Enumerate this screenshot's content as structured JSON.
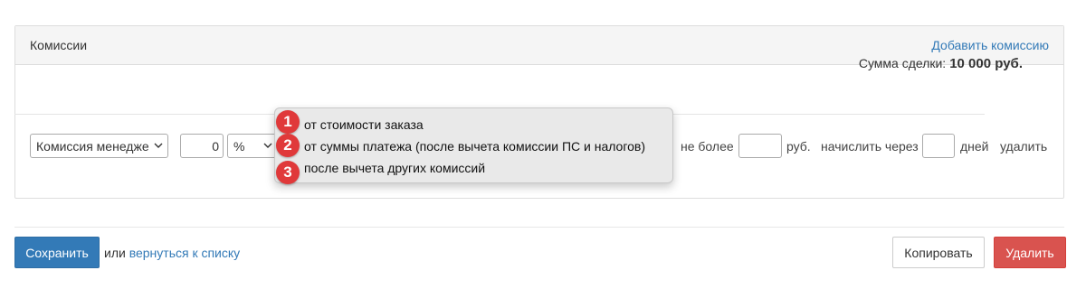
{
  "panel": {
    "title": "Комиссии",
    "add_link": "Добавить комиссию"
  },
  "deal_sum": {
    "label": "Сумма сделки:",
    "value": "10 000 руб."
  },
  "commission_row": {
    "type_select": "Комиссия менедже",
    "amount": "0",
    "unit_select": "%",
    "max_label": "не более",
    "max_value": "",
    "currency": "руб.",
    "accrue_label": "начислить через",
    "days_value": "",
    "days_label": "дней",
    "delete_link": "удалить"
  },
  "dropdown": {
    "options": [
      {
        "badge": "1",
        "label": "от стоимости заказа"
      },
      {
        "badge": "2",
        "label": "от суммы платежа (после вычета комиссии ПС и налогов)"
      },
      {
        "badge": "3",
        "label": "после вычета других комиссий"
      }
    ]
  },
  "footer": {
    "save_label": "Сохранить",
    "or_text": "или",
    "back_link": "вернуться к списку",
    "copy_label": "Копировать",
    "delete_label": "Удалить"
  },
  "colors": {
    "primary": "#337ab7",
    "danger": "#d9534f",
    "badge": "#e0393a"
  }
}
